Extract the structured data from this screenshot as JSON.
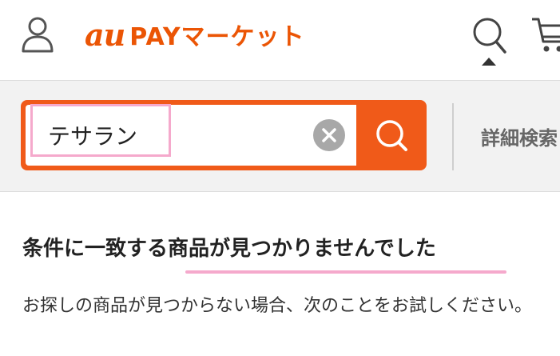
{
  "header": {
    "logo_au": "au",
    "logo_text": "PAYマーケット",
    "icons": {
      "user": "user-icon",
      "search": "search-icon",
      "cart": "cart-icon"
    }
  },
  "search": {
    "query": "テサラン",
    "clear_icon": "close-icon",
    "submit_icon": "search-icon",
    "advanced_label": "詳細検索"
  },
  "result": {
    "title": "条件に一致する商品が見つかりませんでした",
    "message": "お探しの商品が見つからない場合、次のことをお試しください。"
  },
  "colors": {
    "brand_orange": "#eb5505",
    "search_orange": "#f05a19",
    "highlight_pink": "#f5a9cc"
  }
}
